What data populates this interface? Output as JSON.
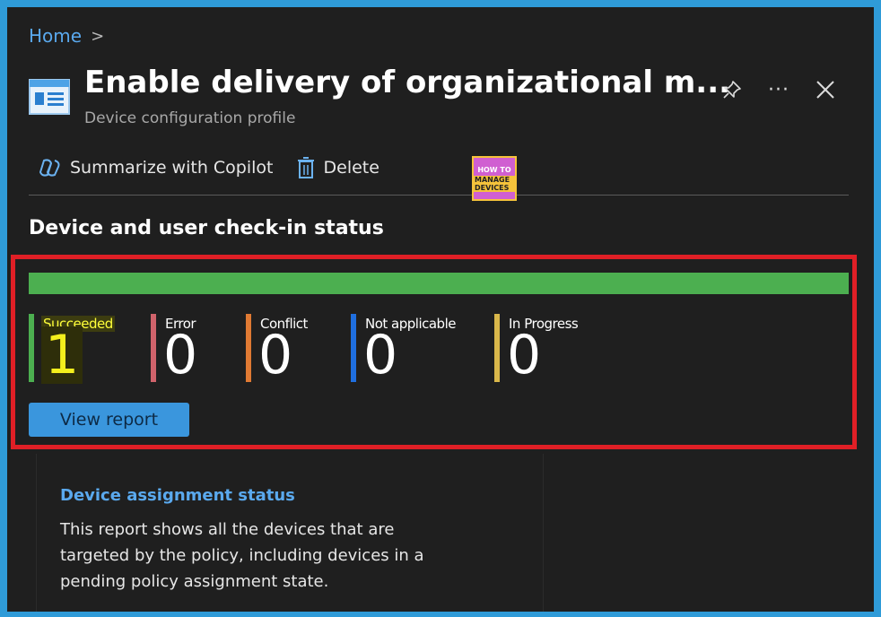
{
  "breadcrumb": {
    "home": "Home",
    "separator": ">"
  },
  "header": {
    "title": "Enable delivery of organizational m...",
    "subtitle": "Device configuration profile",
    "more_label": "···",
    "icons": {
      "page": "profile-window-icon",
      "pin": "pin-icon",
      "more": "ellipsis-icon",
      "close": "close-icon"
    }
  },
  "toolbar": {
    "copilot_label": "Summarize with Copilot",
    "delete_label": "Delete"
  },
  "watermark": {
    "line1": "HOW TO",
    "line2": "MANAGE DEVICES"
  },
  "section": {
    "title": "Device and user check-in status"
  },
  "status": {
    "bar_color": "#4caf50",
    "succeeded_fraction": 1.0,
    "items": [
      {
        "label": "Succeeded",
        "value": "1",
        "color": "#4caf50"
      },
      {
        "label": "Error",
        "value": "0",
        "color": "#d0636b"
      },
      {
        "label": "Conflict",
        "value": "0",
        "color": "#e07a33"
      },
      {
        "label": "Not applicable",
        "value": "0",
        "color": "#1f6fe0"
      },
      {
        "label": "In Progress",
        "value": "0",
        "color": "#d9b74a"
      }
    ]
  },
  "view_report_label": "View report",
  "card": {
    "title": "Device assignment status",
    "text": "This report shows all the devices that are targeted by the policy, including devices in a pending policy assignment state."
  },
  "colors": {
    "accent": "#3a96dd",
    "highlight": "#e01f26",
    "background": "#1f1f1f",
    "frame": "#2f9bd8"
  }
}
